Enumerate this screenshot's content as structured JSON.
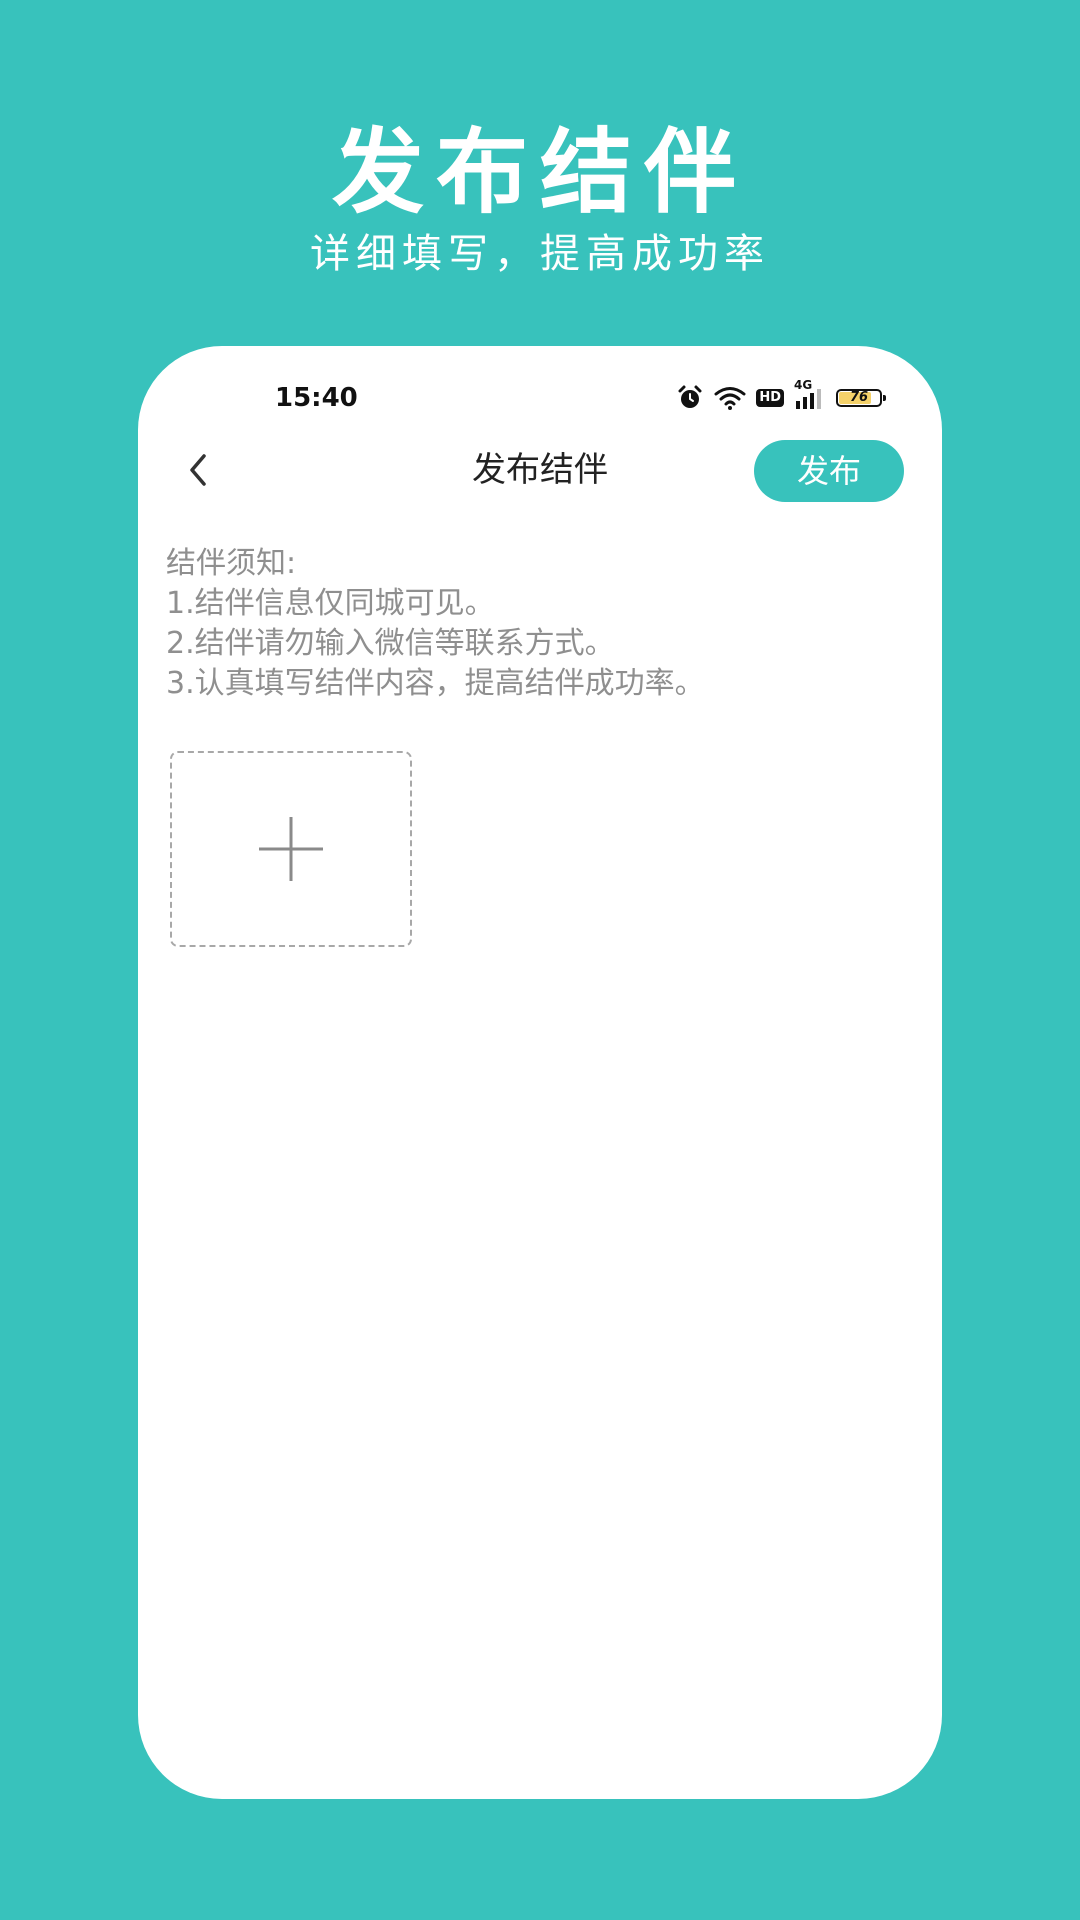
{
  "hero": {
    "title": "发布结伴",
    "subtitle": "详细填写，提高成功率"
  },
  "status_bar": {
    "time": "15:40",
    "network": "4G",
    "hd": "HD",
    "battery": "76",
    "icons": [
      "alarm-icon",
      "wifi-icon",
      "hd-icon",
      "signal-4g-icon",
      "battery-icon"
    ]
  },
  "nav": {
    "title": "发布结伴",
    "publish_label": "发布",
    "back_icon": "chevron-left-icon"
  },
  "notice": {
    "heading": "结伴须知:",
    "items": [
      "1.结伴信息仅同城可见。",
      "2.结伴请勿输入微信等联系方式。",
      "3.认真填写结伴内容，提高结伴成功率。"
    ]
  },
  "upload": {
    "icon": "plus-icon"
  },
  "colors": {
    "accent": "#38C2BC",
    "card": "#FFFFFF",
    "notice_text": "#8F8F8F",
    "title_text": "#222222"
  }
}
